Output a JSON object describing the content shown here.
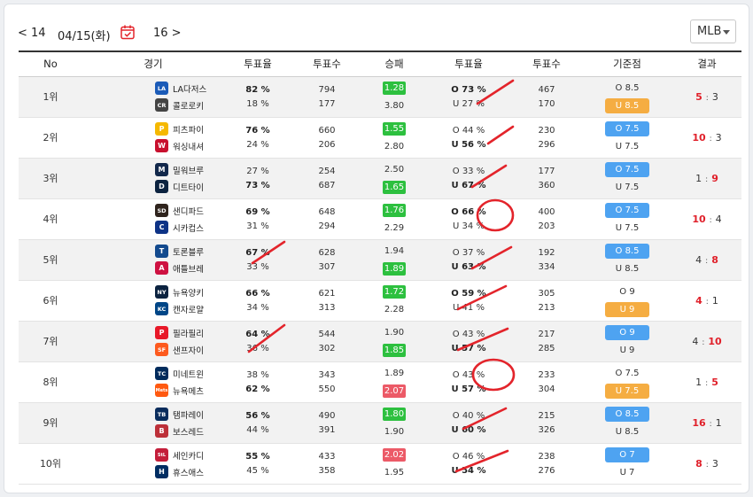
{
  "nav": {
    "prev": "< 14",
    "date": "04/15(화)",
    "next": "16 >",
    "calendar_icon": "calendar-check-icon"
  },
  "league": {
    "selected": "MLB"
  },
  "headers": [
    "No",
    "경기",
    "투표율",
    "투표수",
    "승패",
    "투표율",
    "투표수",
    "기준점",
    "결과"
  ],
  "colors": {
    "green": "#2dc03f",
    "red": "#ec5a67",
    "blue": "#4ea3f1",
    "orange": "#f5ad42",
    "mark": "#e3242b"
  },
  "rows": [
    {
      "rank": "1위",
      "shade": true,
      "teams": [
        {
          "name": "LA다저스",
          "icon": "dodgers-logo-icon",
          "color": "#1b5bb8",
          "glyph": "LA"
        },
        {
          "name": "콜로로키",
          "icon": "rockies-logo-icon",
          "color": "#444444",
          "glyph": "CR"
        }
      ],
      "vote_rate_1": [
        {
          "text": "82 %",
          "bold": true
        },
        {
          "text": "18 %",
          "bold": false
        }
      ],
      "vote_count_1": [
        "794",
        "177"
      ],
      "odds": [
        {
          "text": "1.28",
          "color": "green"
        },
        {
          "text": "3.80",
          "color": ""
        }
      ],
      "vote_rate_2": [
        {
          "text": "O 73 %",
          "bold": true
        },
        {
          "text": "U 27 %",
          "bold": false
        }
      ],
      "vote_count_2": [
        "467",
        "170"
      ],
      "ref": [
        {
          "text": "O 8.5",
          "color": ""
        },
        {
          "text": "U 8.5",
          "color": "orange"
        }
      ],
      "result": {
        "home": "5",
        "away": "3",
        "win": "home"
      }
    },
    {
      "rank": "2위",
      "shade": false,
      "teams": [
        {
          "name": "피츠파이",
          "icon": "pirates-logo-icon",
          "color": "#f5b800",
          "glyph": "P"
        },
        {
          "name": "워싱내셔",
          "icon": "nationals-logo-icon",
          "color": "#c8102e",
          "glyph": "W"
        }
      ],
      "vote_rate_1": [
        {
          "text": "76 %",
          "bold": true
        },
        {
          "text": "24 %",
          "bold": false
        }
      ],
      "vote_count_1": [
        "660",
        "206"
      ],
      "odds": [
        {
          "text": "1.55",
          "color": "green"
        },
        {
          "text": "2.80",
          "color": ""
        }
      ],
      "vote_rate_2": [
        {
          "text": "O 44 %",
          "bold": false
        },
        {
          "text": "U 56 %",
          "bold": true
        }
      ],
      "vote_count_2": [
        "230",
        "296"
      ],
      "ref": [
        {
          "text": "O 7.5",
          "color": "blue"
        },
        {
          "text": "U 7.5",
          "color": ""
        }
      ],
      "result": {
        "home": "10",
        "away": "3",
        "win": "home"
      }
    },
    {
      "rank": "3위",
      "shade": true,
      "teams": [
        {
          "name": "밀워브루",
          "icon": "brewers-logo-icon",
          "color": "#12284b",
          "glyph": "M"
        },
        {
          "name": "디트타이",
          "icon": "tigers-logo-icon",
          "color": "#0c2340",
          "glyph": "D"
        }
      ],
      "vote_rate_1": [
        {
          "text": "27 %",
          "bold": false
        },
        {
          "text": "73 %",
          "bold": true
        }
      ],
      "vote_count_1": [
        "254",
        "687"
      ],
      "odds": [
        {
          "text": "2.50",
          "color": ""
        },
        {
          "text": "1.65",
          "color": "green"
        }
      ],
      "vote_rate_2": [
        {
          "text": "O 33 %",
          "bold": false
        },
        {
          "text": "U 67 %",
          "bold": true
        }
      ],
      "vote_count_2": [
        "177",
        "360"
      ],
      "ref": [
        {
          "text": "O 7.5",
          "color": "blue"
        },
        {
          "text": "U 7.5",
          "color": ""
        }
      ],
      "result": {
        "home": "1",
        "away": "9",
        "win": "away"
      }
    },
    {
      "rank": "4위",
      "shade": false,
      "teams": [
        {
          "name": "샌디파드",
          "icon": "padres-logo-icon",
          "color": "#2f241d",
          "glyph": "SD"
        },
        {
          "name": "시카컵스",
          "icon": "cubs-logo-icon",
          "color": "#0e3386",
          "glyph": "C"
        }
      ],
      "vote_rate_1": [
        {
          "text": "69 %",
          "bold": true
        },
        {
          "text": "31 %",
          "bold": false
        }
      ],
      "vote_count_1": [
        "648",
        "294"
      ],
      "odds": [
        {
          "text": "1.76",
          "color": "green"
        },
        {
          "text": "2.29",
          "color": ""
        }
      ],
      "vote_rate_2": [
        {
          "text": "O 66 %",
          "bold": true
        },
        {
          "text": "U 34 %",
          "bold": false
        }
      ],
      "vote_count_2": [
        "400",
        "203"
      ],
      "ref": [
        {
          "text": "O 7.5",
          "color": "blue"
        },
        {
          "text": "U 7.5",
          "color": ""
        }
      ],
      "result": {
        "home": "10",
        "away": "4",
        "win": "home"
      }
    },
    {
      "rank": "5위",
      "shade": true,
      "teams": [
        {
          "name": "토론블루",
          "icon": "bluejays-logo-icon",
          "color": "#134a8e",
          "glyph": "T"
        },
        {
          "name": "애틀브레",
          "icon": "braves-logo-icon",
          "color": "#ce1141",
          "glyph": "A"
        }
      ],
      "vote_rate_1": [
        {
          "text": "67 %",
          "bold": true
        },
        {
          "text": "33 %",
          "bold": false
        }
      ],
      "vote_count_1": [
        "628",
        "307"
      ],
      "odds": [
        {
          "text": "1.94",
          "color": ""
        },
        {
          "text": "1.89",
          "color": "green"
        }
      ],
      "vote_rate_2": [
        {
          "text": "O 37 %",
          "bold": false
        },
        {
          "text": "U 63 %",
          "bold": true
        }
      ],
      "vote_count_2": [
        "192",
        "334"
      ],
      "ref": [
        {
          "text": "O 8.5",
          "color": "blue"
        },
        {
          "text": "U 8.5",
          "color": ""
        }
      ],
      "result": {
        "home": "4",
        "away": "8",
        "win": "away"
      }
    },
    {
      "rank": "6위",
      "shade": false,
      "teams": [
        {
          "name": "뉴욕양키",
          "icon": "yankees-logo-icon",
          "color": "#0c2340",
          "glyph": "NY"
        },
        {
          "name": "캔자로얄",
          "icon": "royals-logo-icon",
          "color": "#004687",
          "glyph": "KC"
        }
      ],
      "vote_rate_1": [
        {
          "text": "66 %",
          "bold": true
        },
        {
          "text": "34 %",
          "bold": false
        }
      ],
      "vote_count_1": [
        "621",
        "313"
      ],
      "odds": [
        {
          "text": "1.72",
          "color": "green"
        },
        {
          "text": "2.28",
          "color": ""
        }
      ],
      "vote_rate_2": [
        {
          "text": "O 59 %",
          "bold": true
        },
        {
          "text": "U 41 %",
          "bold": false
        }
      ],
      "vote_count_2": [
        "305",
        "213"
      ],
      "ref": [
        {
          "text": "O 9",
          "color": ""
        },
        {
          "text": "U 9",
          "color": "orange"
        }
      ],
      "result": {
        "home": "4",
        "away": "1",
        "win": "home"
      }
    },
    {
      "rank": "7위",
      "shade": true,
      "teams": [
        {
          "name": "필라필리",
          "icon": "phillies-logo-icon",
          "color": "#e81828",
          "glyph": "P"
        },
        {
          "name": "샌프자이",
          "icon": "giants-logo-icon",
          "color": "#fd5a1e",
          "glyph": "SF"
        }
      ],
      "vote_rate_1": [
        {
          "text": "64 %",
          "bold": true
        },
        {
          "text": "36 %",
          "bold": false
        }
      ],
      "vote_count_1": [
        "544",
        "302"
      ],
      "odds": [
        {
          "text": "1.90",
          "color": ""
        },
        {
          "text": "1.85",
          "color": "green"
        }
      ],
      "vote_rate_2": [
        {
          "text": "O 43 %",
          "bold": false
        },
        {
          "text": "U 57 %",
          "bold": true
        }
      ],
      "vote_count_2": [
        "217",
        "285"
      ],
      "ref": [
        {
          "text": "O 9",
          "color": "blue"
        },
        {
          "text": "U 9",
          "color": ""
        }
      ],
      "result": {
        "home": "4",
        "away": "10",
        "win": "away"
      }
    },
    {
      "rank": "8위",
      "shade": false,
      "teams": [
        {
          "name": "미네트윈",
          "icon": "twins-logo-icon",
          "color": "#002b5c",
          "glyph": "TC"
        },
        {
          "name": "뉴욕메츠",
          "icon": "mets-logo-icon",
          "color": "#ff5910",
          "glyph": "Mets"
        }
      ],
      "vote_rate_1": [
        {
          "text": "38 %",
          "bold": false
        },
        {
          "text": "62 %",
          "bold": true
        }
      ],
      "vote_count_1": [
        "343",
        "550"
      ],
      "odds": [
        {
          "text": "1.89",
          "color": ""
        },
        {
          "text": "2.07",
          "color": "red"
        }
      ],
      "vote_rate_2": [
        {
          "text": "O 43 %",
          "bold": false
        },
        {
          "text": "U 57 %",
          "bold": true
        }
      ],
      "vote_count_2": [
        "233",
        "304"
      ],
      "ref": [
        {
          "text": "O 7.5",
          "color": ""
        },
        {
          "text": "U 7.5",
          "color": "orange"
        }
      ],
      "result": {
        "home": "1",
        "away": "5",
        "win": "away"
      }
    },
    {
      "rank": "9위",
      "shade": true,
      "teams": [
        {
          "name": "탬파레이",
          "icon": "rays-logo-icon",
          "color": "#092c5c",
          "glyph": "TB"
        },
        {
          "name": "보스레드",
          "icon": "redsox-logo-icon",
          "color": "#bd3039",
          "glyph": "B"
        }
      ],
      "vote_rate_1": [
        {
          "text": "56 %",
          "bold": true
        },
        {
          "text": "44 %",
          "bold": false
        }
      ],
      "vote_count_1": [
        "490",
        "391"
      ],
      "odds": [
        {
          "text": "1.80",
          "color": "green"
        },
        {
          "text": "1.90",
          "color": ""
        }
      ],
      "vote_rate_2": [
        {
          "text": "O 40 %",
          "bold": false
        },
        {
          "text": "U 60 %",
          "bold": true
        }
      ],
      "vote_count_2": [
        "215",
        "326"
      ],
      "ref": [
        {
          "text": "O 8.5",
          "color": "blue"
        },
        {
          "text": "U 8.5",
          "color": ""
        }
      ],
      "result": {
        "home": "16",
        "away": "1",
        "win": "home"
      }
    },
    {
      "rank": "10위",
      "shade": false,
      "teams": [
        {
          "name": "세인카디",
          "icon": "cardinals-logo-icon",
          "color": "#c41e3a",
          "glyph": "StL"
        },
        {
          "name": "휴스애스",
          "icon": "astros-logo-icon",
          "color": "#002d62",
          "glyph": "H"
        }
      ],
      "vote_rate_1": [
        {
          "text": "55 %",
          "bold": true
        },
        {
          "text": "45 %",
          "bold": false
        }
      ],
      "vote_count_1": [
        "433",
        "358"
      ],
      "odds": [
        {
          "text": "2.02",
          "color": "red"
        },
        {
          "text": "1.95",
          "color": ""
        }
      ],
      "vote_rate_2": [
        {
          "text": "O 46 %",
          "bold": false
        },
        {
          "text": "U 54 %",
          "bold": true
        }
      ],
      "vote_count_2": [
        "238",
        "276"
      ],
      "ref": [
        {
          "text": "O 7",
          "color": "blue"
        },
        {
          "text": "U 7",
          "color": ""
        }
      ],
      "result": {
        "home": "8",
        "away": "3",
        "win": "home"
      }
    }
  ]
}
